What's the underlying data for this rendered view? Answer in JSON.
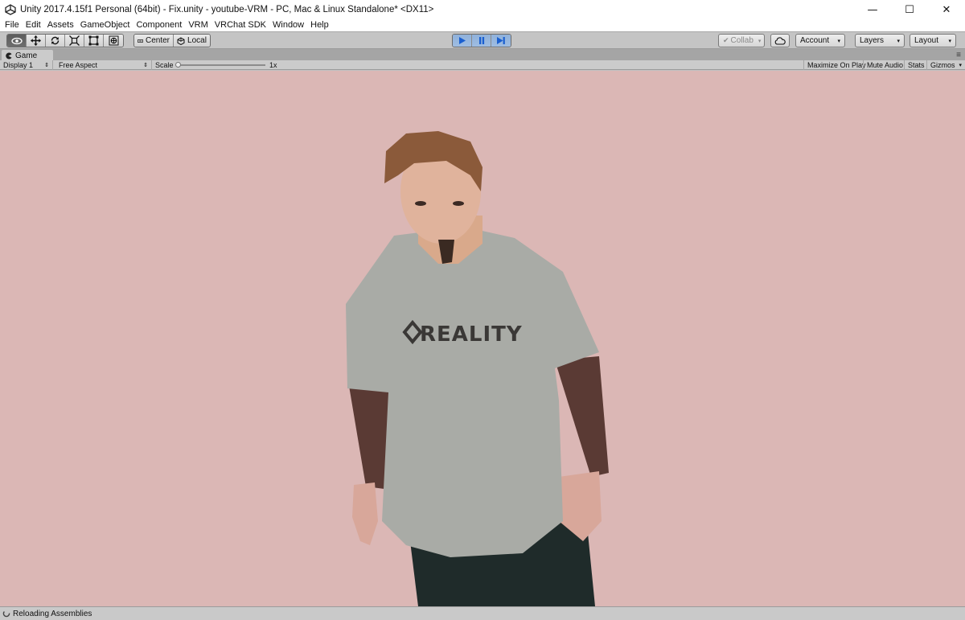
{
  "window": {
    "title": "Unity 2017.4.15f1 Personal (64bit) - Fix.unity - youtube-VRM - PC, Mac & Linux Standalone* <DX11>",
    "minimize_glyph": "—",
    "maximize_glyph": "☐",
    "close_glyph": "✕"
  },
  "menu": [
    "File",
    "Edit",
    "Assets",
    "GameObject",
    "Component",
    "VRM",
    "VRChat SDK",
    "Window",
    "Help"
  ],
  "toolbar": {
    "transform_tools": [
      {
        "name": "hand-tool-icon",
        "glyph": "👁",
        "active": true
      },
      {
        "name": "move-tool-icon",
        "glyph": "✥",
        "active": false
      },
      {
        "name": "rotate-tool-icon",
        "glyph": "⟳",
        "active": false
      },
      {
        "name": "scale-tool-icon",
        "glyph": "⤧",
        "active": false
      },
      {
        "name": "rect-tool-icon",
        "glyph": "⬚",
        "active": false
      },
      {
        "name": "transform-tool-icon",
        "glyph": "⊕",
        "active": false
      }
    ],
    "pivot_label": "Center",
    "space_label": "Local",
    "play_glyph": "▶",
    "pause_glyph": "❚❚",
    "step_glyph": "▶|",
    "collab_label": "Collab",
    "account_label": "Account",
    "layers_label": "Layers",
    "layout_label": "Layout",
    "dropdown_arrow": "▾"
  },
  "game_tab": {
    "label": "Game",
    "display_label": "Display 1",
    "aspect_label": "Free Aspect",
    "scale_label": "Scale",
    "scale_value": "1x",
    "scale_position": 0.0,
    "maximize_label": "Maximize On Play",
    "mute_label": "Mute Audio",
    "stats_label": "Stats",
    "gizmos_label": "Gizmos"
  },
  "viewport": {
    "background_color": "#dbb7b5",
    "shirt_text": "REALITY"
  },
  "status": {
    "text": "Reloading Assemblies"
  },
  "colors": {
    "play_active": "#8fb1da",
    "play_icon": "#1a5fd0"
  }
}
